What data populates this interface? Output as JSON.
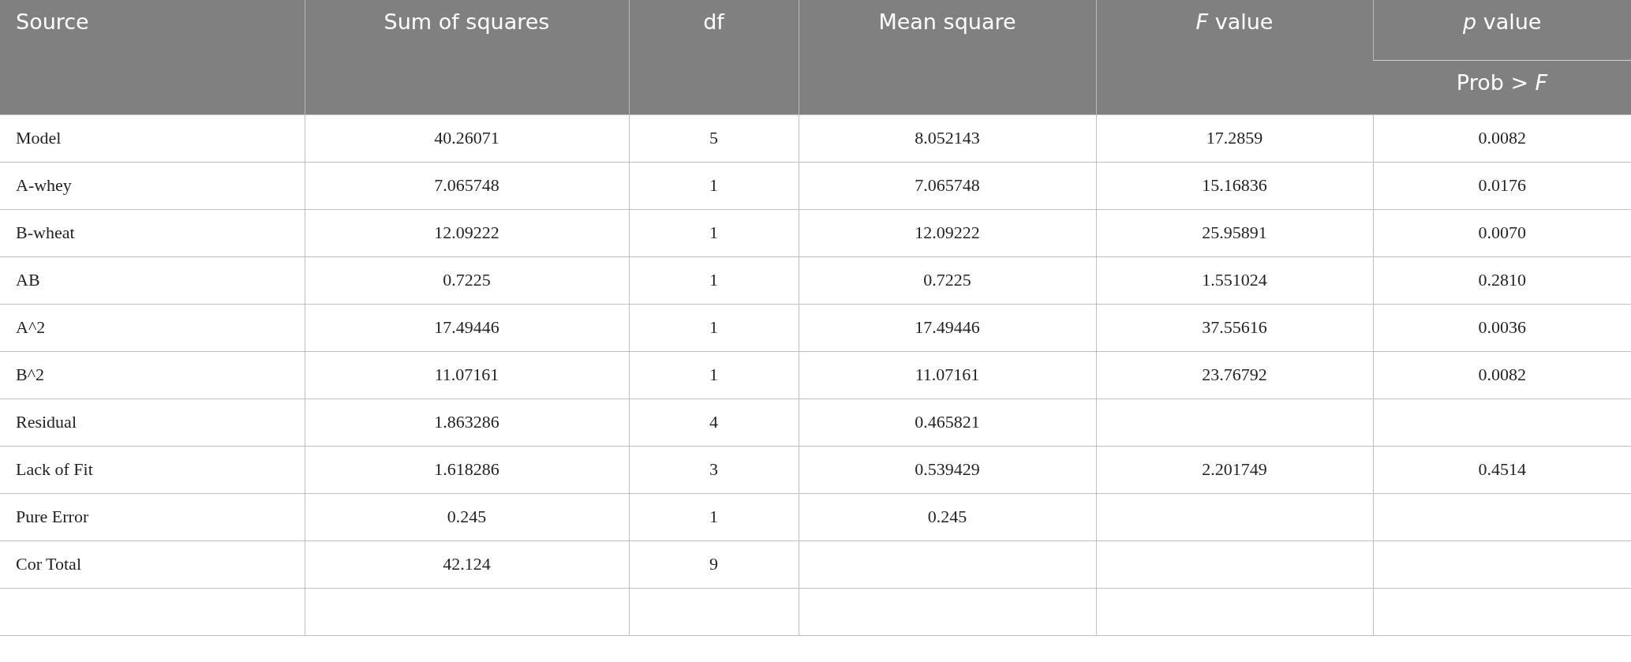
{
  "table": {
    "columns": [
      {
        "label": "Source"
      },
      {
        "label": "Sum of squares"
      },
      {
        "label": "df"
      },
      {
        "label": "Mean square"
      },
      {
        "label": "*F* value"
      },
      {
        "label": "*p* value",
        "sublabel": "Prob > *F*"
      }
    ],
    "rows": [
      [
        "Model",
        "40.26071",
        "5",
        "8.052143",
        "17.2859",
        "0.0082"
      ],
      [
        "A-whey",
        "7.065748",
        "1",
        "7.065748",
        "15.16836",
        "0.0176"
      ],
      [
        "B-wheat",
        "12.09222",
        "1",
        "12.09222",
        "25.95891",
        "0.0070"
      ],
      [
        "AB",
        "0.7225",
        "1",
        "0.7225",
        "1.551024",
        "0.2810"
      ],
      [
        "A^2",
        "17.49446",
        "1",
        "17.49446",
        "37.55616",
        "0.0036"
      ],
      [
        "B^2",
        "11.07161",
        "1",
        "11.07161",
        "23.76792",
        "0.0082"
      ],
      [
        "Residual",
        "1.863286",
        "4",
        "0.465821",
        null,
        null
      ],
      [
        "Lack of Fit",
        "1.618286",
        "3",
        "0.539429",
        "2.201749",
        "0.4514"
      ],
      [
        "Pure Error",
        "0.245",
        "1",
        "0.245",
        null,
        null
      ],
      [
        "Cor Total",
        "42.124",
        "9",
        null,
        null,
        null
      ],
      [
        null,
        null,
        null,
        null,
        null,
        null
      ]
    ]
  }
}
